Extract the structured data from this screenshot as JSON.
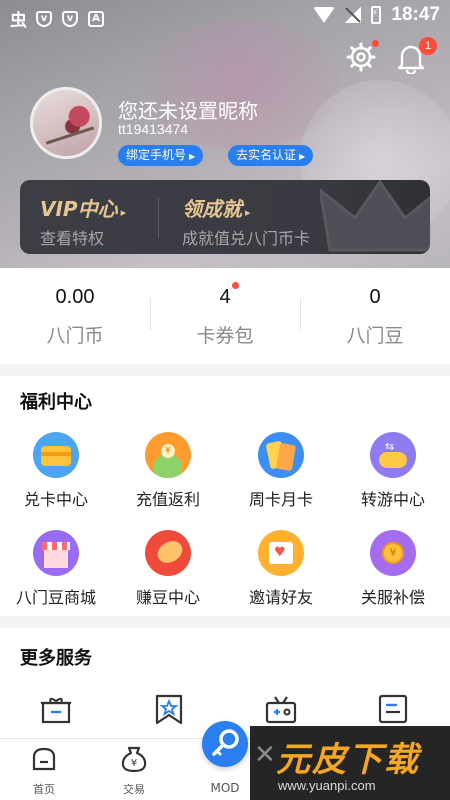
{
  "status_bar": {
    "time": "18:47",
    "logo": "虫"
  },
  "header": {
    "settings_icon": "gear-icon",
    "notifications_badge": "1",
    "nickname": "您还未设置昵称",
    "user_id": "tt19413474",
    "bind_phone_label": "绑定手机号",
    "verify_name_label": "去实名认证"
  },
  "vip_card": {
    "vip_title": "VIP中心",
    "vip_sub": "查看特权",
    "achievement_title": "领成就",
    "achievement_sub": "成就值兑八门币卡"
  },
  "stats": [
    {
      "value": "0.00",
      "label": "八门币"
    },
    {
      "value": "4",
      "label": "卡券包"
    },
    {
      "value": "0",
      "label": "八门豆"
    }
  ],
  "welfare": {
    "title": "福利中心",
    "items": [
      {
        "label": "兑卡中心",
        "icon": "card-exchange-icon"
      },
      {
        "label": "充值返利",
        "icon": "recharge-rebate-icon"
      },
      {
        "label": "周卡月卡",
        "icon": "weekly-monthly-card-icon"
      },
      {
        "label": "转游中心",
        "icon": "game-transfer-icon"
      },
      {
        "label": "八门豆商城",
        "icon": "bean-mall-icon"
      },
      {
        "label": "赚豆中心",
        "icon": "earn-beans-icon"
      },
      {
        "label": "邀请好友",
        "icon": "invite-friends-icon"
      },
      {
        "label": "关服补偿",
        "icon": "server-close-compensation-icon"
      }
    ]
  },
  "more_services": {
    "title": "更多服务"
  },
  "tabbar": {
    "home": "首页",
    "trade": "交易",
    "mod": "MOD"
  },
  "watermark": {
    "title": "元皮下载",
    "url": "www.yuanpi.com"
  },
  "colors": {
    "accent": "#2a7ff0",
    "badge": "#ff4b3a",
    "vip_gold": "#e5c690"
  }
}
